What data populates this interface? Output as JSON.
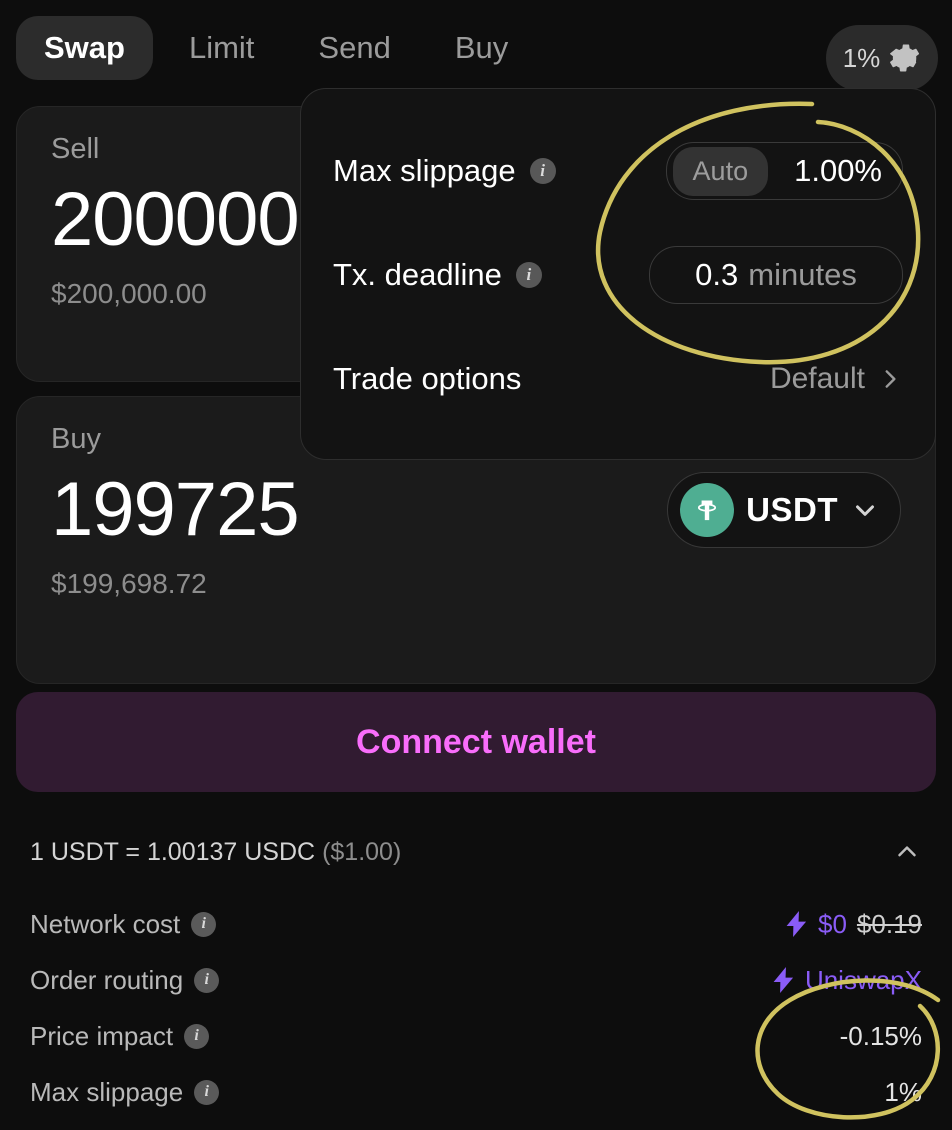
{
  "topbar": {
    "tabs": [
      {
        "label": "Swap",
        "active": true
      },
      {
        "label": "Limit",
        "active": false
      },
      {
        "label": "Send",
        "active": false
      },
      {
        "label": "Buy",
        "active": false
      }
    ],
    "settings_chip": {
      "slippage": "1%",
      "icon": "gear-icon"
    }
  },
  "sell_card": {
    "label": "Sell",
    "amount": "200000",
    "fiat": "$200,000.00"
  },
  "buy_card": {
    "label": "Buy",
    "amount": "199725",
    "fiat": "$199,698.72",
    "token": {
      "symbol": "USDT",
      "logo_letter": "T",
      "logo_color": "#4fae92"
    }
  },
  "connect_button": {
    "label": "Connect wallet"
  },
  "rate_row": {
    "text": "1 USDT = 1.00137 USDC",
    "fiat": "($1.00)",
    "chevron": "chevron-up-icon"
  },
  "details": [
    {
      "label": "Network cost",
      "value": "$0",
      "value_struck": "$0.19",
      "has_bolt": true,
      "accent": true
    },
    {
      "label": "Order routing",
      "value": "UniswapX",
      "value_struck": "",
      "has_bolt": true,
      "accent": true
    },
    {
      "label": "Price impact",
      "value": "-0.15%",
      "value_struck": "",
      "has_bolt": false,
      "accent": false
    },
    {
      "label": "Max slippage",
      "value": "1%",
      "value_struck": "",
      "has_bolt": false,
      "accent": false
    }
  ],
  "settings_popup": {
    "max_slippage": {
      "label": "Max slippage",
      "auto_label": "Auto",
      "value": "1.00%"
    },
    "tx_deadline": {
      "label": "Tx. deadline",
      "value": "0.3",
      "unit": "minutes"
    },
    "trade_options": {
      "label": "Trade options",
      "value": "Default",
      "chevron": "chevron-right-icon"
    }
  },
  "annotations": {
    "stroke_color": "#d0c25f",
    "shapes": [
      "ellipse-around-slippage-and-deadline",
      "ellipse-around-price-impact-and-max-slippage"
    ]
  }
}
